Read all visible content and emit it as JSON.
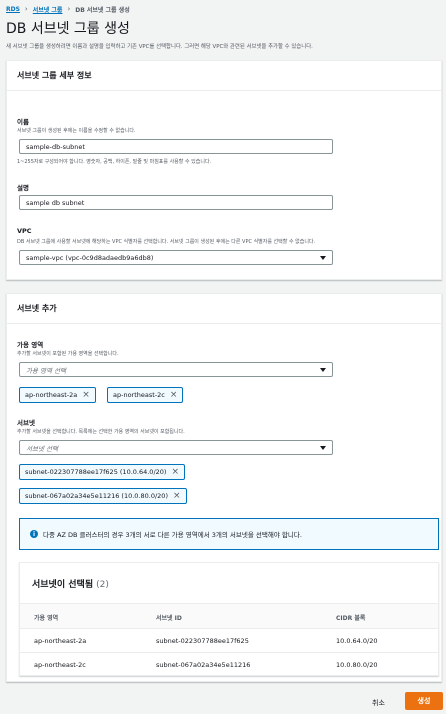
{
  "breadcrumb": {
    "rds": "RDS",
    "subnet_groups": "서브넷 그룹",
    "current": "DB 서브넷 그룹 생성"
  },
  "page": {
    "title": "DB 서브넷 그룹 생성",
    "description": "새 서브넷 그룹을 생성하려면 이름과 설명을 입력하고 기존 VPC를 선택합니다. 그러면 해당 VPC와 관련된 서브넷을 추가할 수 있습니다."
  },
  "details": {
    "header": "서브넷 그룹 세부 정보",
    "name_label": "이름",
    "name_desc": "서브넷 그룹이 생성된 후에는 이름을 수정할 수 없습니다.",
    "name_value": "sample-db-subnet",
    "name_constraint": "1~255자로 구성되어야 합니다. 영숫자, 공백, 하이픈, 밑줄 및 마침표를 사용할 수 있습니다.",
    "desc_label": "설명",
    "desc_value": "sample db subnet",
    "vpc_label": "VPC",
    "vpc_desc": "DB 서브넷 그룹에 사용할 서브넷에 해당하는 VPC 식별자를 선택합니다. 서브넷 그룹이 생성된 후에는 다른 VPC 식별자를 선택할 수 없습니다.",
    "vpc_value": "sample-vpc (vpc-0c9d8adaedb9a6db8)"
  },
  "add_subnets": {
    "header": "서브넷 추가",
    "az_label": "가용 영역",
    "az_desc": "추가할 서브넷이 포함된 가용 영역을 선택합니다.",
    "az_placeholder": "가용 영역 선택",
    "az_tokens": [
      "ap-northeast-2a",
      "ap-northeast-2c"
    ],
    "subnet_label": "서브넷",
    "subnet_desc": "추가할 서브넷을 선택합니다. 목록에는 선택한 가용 영역의 서브넷이 포함됩니다.",
    "subnet_placeholder": "서브넷 선택",
    "subnet_tokens": [
      "subnet-022307788ee17f625 (10.0.64.0/20)",
      "subnet-067a02a34e5e11216 (10.0.80.0/20)"
    ],
    "info_icon": "info-icon",
    "info_text": "다중 AZ DB 클러스터의 경우 3개의 서로 다른 가용 영역에서 3개의 서브넷을 선택해야 합니다."
  },
  "selected": {
    "title": "서브넷이 선택됨",
    "count": "(2)",
    "columns": [
      "가용 영역",
      "서브넷 ID",
      "CIDR 블록"
    ],
    "rows": [
      [
        "ap-northeast-2a",
        "subnet-022307788ee17f625",
        "10.0.64.0/20"
      ],
      [
        "ap-northeast-2c",
        "subnet-067a02a34e5e11216",
        "10.0.80.0/20"
      ]
    ]
  },
  "footer": {
    "cancel": "취소",
    "create": "생성"
  },
  "colors": {
    "primary": "#ec7211",
    "link": "#0073bb",
    "info_bg": "#f1faff"
  }
}
